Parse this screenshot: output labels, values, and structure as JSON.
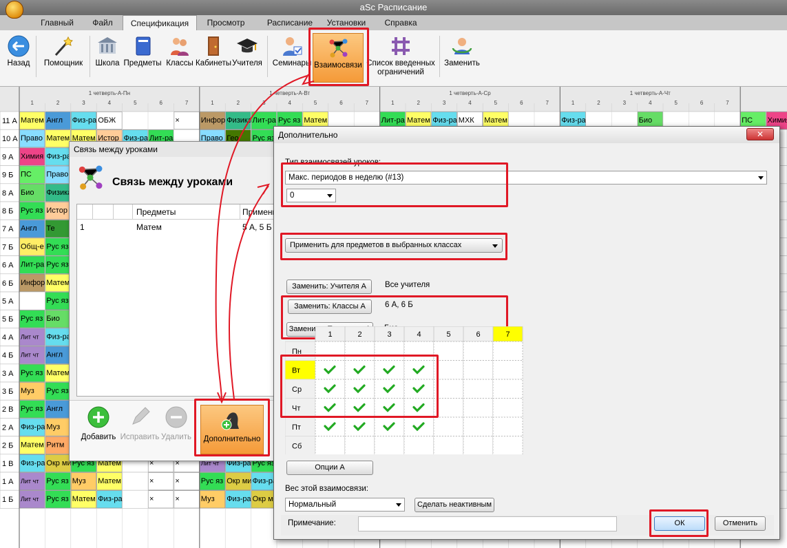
{
  "app": {
    "title": "aSc Расписание"
  },
  "menu": [
    "Главный",
    "Файл",
    "Спецификация",
    "Просмотр",
    "Расписание",
    "Установки",
    "Справка"
  ],
  "ribbon": {
    "back": "Назад",
    "wizard": "Помощник",
    "school": "Школа",
    "subjects": "Предметы",
    "classes": "Классы",
    "rooms": "Кабинеты",
    "teachers": "Учителя",
    "seminars": "Семинары",
    "relations": "Взаимосвязи",
    "constraints_line1": "Список введенных",
    "constraints_line2": "ограничений",
    "replace": "Заменить"
  },
  "grid": {
    "day_headers": [
      "1 четверть-А-Пн",
      "1 четверть-А-Вт",
      "1 четверть-А-Ср",
      "1 четверть-А-Чт"
    ],
    "periods": [
      "1",
      "2",
      "3",
      "4",
      "5",
      "6",
      "7"
    ],
    "rows": [
      {
        "cls": "11 А",
        "cells": [
          "Матем",
          "Англ",
          "Физ-ра",
          "ОБЖ",
          "",
          "",
          "×",
          "Инфор",
          "Физика",
          "Лит-ра",
          "Рус яз",
          "Матем",
          "",
          "",
          "Лит-ра",
          "Матем",
          "Физ-ра",
          "МХК",
          "Матем",
          "",
          "",
          "Физ-ра",
          "",
          "",
          "Био",
          "",
          "",
          "",
          "ПС",
          "Химия"
        ]
      },
      {
        "cls": "10 А",
        "cells": [
          "Право",
          "Матем",
          "Матем",
          "Истор",
          "Физ-ра",
          "Лит-ра",
          "",
          "Право",
          "Гео",
          "Рус яз",
          "",
          "",
          "",
          "",
          "",
          "",
          "",
          "",
          "",
          "",
          "",
          "",
          "",
          "",
          "",
          "",
          "",
          "",
          "",
          ""
        ]
      },
      {
        "cls": "9 А",
        "cells": [
          "Химия",
          "Физ-ра",
          "",
          "",
          "",
          "",
          "",
          "",
          "",
          "",
          "",
          "",
          "",
          "",
          "",
          "",
          "",
          "",
          "",
          "",
          "",
          "",
          "",
          "",
          "",
          "",
          "",
          "",
          "",
          ""
        ]
      },
      {
        "cls": "9 Б",
        "cells": [
          "ПС",
          "Право",
          "",
          "",
          "",
          "",
          "",
          "",
          "",
          "",
          "",
          "",
          "",
          "",
          "",
          "",
          "",
          "",
          "",
          "",
          "",
          "",
          "",
          "",
          "",
          "",
          "",
          "",
          "",
          ""
        ]
      },
      {
        "cls": "8 А",
        "cells": [
          "Био",
          "Физика",
          "",
          "",
          "",
          "",
          "",
          "",
          "",
          "",
          "",
          "",
          "",
          "",
          "",
          "",
          "",
          "",
          "",
          "",
          "",
          "",
          "",
          "",
          "",
          "",
          "",
          "",
          "",
          ""
        ]
      },
      {
        "cls": "8 Б",
        "cells": [
          "Рус яз",
          "Истор",
          "",
          "",
          "",
          "",
          "",
          "",
          "",
          "",
          "",
          "",
          "",
          "",
          "",
          "",
          "",
          "",
          "",
          "",
          "",
          "",
          "",
          "",
          "",
          "",
          "",
          "",
          "",
          ""
        ]
      },
      {
        "cls": "7 А",
        "cells": [
          "Англ",
          "Те",
          "",
          "",
          "",
          "",
          "",
          "",
          "",
          "",
          "",
          "",
          "",
          "",
          "",
          "",
          "",
          "",
          "",
          "",
          "",
          "",
          "",
          "",
          "",
          "",
          "",
          "",
          "",
          ""
        ]
      },
      {
        "cls": "7 Б",
        "cells": [
          "Общ-е",
          "Рус яз",
          "",
          "",
          "",
          "",
          "",
          "",
          "",
          "",
          "",
          "",
          "",
          "",
          "",
          "",
          "",
          "",
          "",
          "",
          "",
          "",
          "",
          "",
          "",
          "",
          "",
          "",
          "",
          ""
        ]
      },
      {
        "cls": "6 А",
        "cells": [
          "Лит-ра",
          "Рус яз",
          "",
          "",
          "",
          "",
          "",
          "",
          "",
          "",
          "",
          "",
          "",
          "",
          "",
          "",
          "",
          "",
          "",
          "",
          "",
          "",
          "",
          "",
          "",
          "",
          "",
          "",
          "",
          ""
        ]
      },
      {
        "cls": "6 Б",
        "cells": [
          "Инфор",
          "Матем",
          "",
          "",
          "",
          "",
          "",
          "",
          "",
          "",
          "",
          "",
          "",
          "",
          "",
          "",
          "",
          "",
          "",
          "",
          "",
          "",
          "",
          "",
          "",
          "",
          "",
          "",
          "",
          ""
        ]
      },
      {
        "cls": "5 А",
        "cells": [
          "",
          "Рус яз",
          "",
          "",
          "",
          "",
          "",
          "",
          "",
          "",
          "",
          "",
          "",
          "",
          "",
          "",
          "",
          "",
          "",
          "",
          "",
          "",
          "",
          "",
          "",
          "",
          "",
          "",
          "",
          ""
        ]
      },
      {
        "cls": "5 Б",
        "cells": [
          "Рус яз",
          "Био",
          "",
          "",
          "",
          "",
          "",
          "",
          "",
          "",
          "",
          "",
          "",
          "",
          "",
          "",
          "",
          "",
          "",
          "",
          "",
          "",
          "",
          "",
          "",
          "",
          "",
          "",
          "",
          ""
        ]
      },
      {
        "cls": "4 А",
        "cells": [
          "Лит чтение",
          "Физ-ра",
          "",
          "",
          "",
          "",
          "",
          "",
          "",
          "",
          "",
          "",
          "",
          "",
          "",
          "",
          "",
          "",
          "",
          "",
          "",
          "",
          "",
          "",
          "",
          "",
          "",
          "",
          "",
          ""
        ]
      },
      {
        "cls": "4 Б",
        "cells": [
          "Лит чтение",
          "Англ",
          "",
          "",
          "",
          "",
          "",
          "",
          "",
          "",
          "",
          "",
          "",
          "",
          "",
          "",
          "",
          "",
          "",
          "",
          "",
          "",
          "",
          "",
          "",
          "",
          "",
          "",
          "",
          ""
        ]
      },
      {
        "cls": "3 А",
        "cells": [
          "Рус яз",
          "Матем",
          "",
          "",
          "",
          "",
          "",
          "",
          "",
          "",
          "",
          "",
          "",
          "",
          "",
          "",
          "",
          "",
          "",
          "",
          "",
          "",
          "",
          "",
          "",
          "",
          "",
          "",
          "",
          ""
        ]
      },
      {
        "cls": "3 Б",
        "cells": [
          "Муз",
          "Рус яз",
          "",
          "",
          "",
          "",
          "",
          "",
          "",
          "",
          "",
          "",
          "",
          "",
          "",
          "",
          "",
          "",
          "",
          "",
          "",
          "",
          "",
          "",
          "",
          "",
          "",
          "",
          "",
          ""
        ]
      },
      {
        "cls": "2 В",
        "cells": [
          "Рус яз",
          "Англ",
          "",
          "",
          "",
          "",
          "",
          "",
          "",
          "",
          "",
          "",
          "",
          "",
          "",
          "",
          "",
          "",
          "",
          "",
          "",
          "",
          "",
          "",
          "",
          "",
          "",
          "",
          "",
          ""
        ]
      },
      {
        "cls": "2 А",
        "cells": [
          "Физ-ра",
          "Муз",
          "",
          "",
          "",
          "",
          "",
          "",
          "",
          "",
          "",
          "",
          "",
          "",
          "",
          "",
          "",
          "",
          "",
          "",
          "",
          "",
          "",
          "",
          "",
          "",
          "",
          "",
          "",
          ""
        ]
      },
      {
        "cls": "2 Б",
        "cells": [
          "Матем",
          "Ритм",
          "",
          "",
          "",
          "",
          "",
          "",
          "",
          "",
          "",
          "",
          "",
          "",
          "",
          "",
          "",
          "",
          "",
          "",
          "",
          "",
          "",
          "",
          "",
          "",
          "",
          "",
          "",
          ""
        ]
      },
      {
        "cls": "1 В",
        "cells": [
          "Физ-ра",
          "Окр мир",
          "Рус яз",
          "Матем",
          "",
          "×",
          "×",
          "Лит чтение",
          "Физ-ра",
          "Рус яз",
          "",
          "",
          "",
          "",
          "",
          "",
          "",
          "",
          "",
          "",
          "",
          "",
          "",
          "",
          "",
          "",
          "",
          "",
          "",
          ""
        ]
      },
      {
        "cls": "1 А",
        "cells": [
          "Лит чтение",
          "Рус яз",
          "Муз",
          "Матем",
          "",
          "×",
          "×",
          "Рус яз",
          "Окр мир",
          "Физ-ра",
          "",
          "",
          "",
          "",
          "",
          "",
          "",
          "",
          "",
          "",
          "",
          "",
          "",
          "",
          "",
          "",
          "",
          "",
          "",
          ""
        ]
      },
      {
        "cls": "1 Б",
        "cells": [
          "Лит чтение",
          "Рус яз",
          "Матем",
          "Физ-ра",
          "",
          "×",
          "×",
          "Муз",
          "Физ-ра",
          "Окр мир",
          "",
          "",
          "",
          "",
          "",
          "",
          "",
          "",
          "",
          "",
          "",
          "",
          "",
          "",
          "",
          "",
          "",
          "",
          "",
          ""
        ]
      }
    ]
  },
  "dlg1": {
    "title": "Связь между уроками",
    "heading": "Связь между уроками",
    "col_subjects": "Предметы",
    "col_apply": "Примени",
    "row_num": "1",
    "row_subject": "Матем",
    "row_apply": "5 А, 5 Б",
    "add": "Добавить",
    "edit": "Исправить",
    "delete": "Удалить",
    "extra": "Дополнительно"
  },
  "dlg2": {
    "title": "Дополнительно",
    "type_label": "Тип взаимосвязей уроков:",
    "type_value": "Макс. периодов в неделю (#13)",
    "count_value": "0",
    "apply_value": "Применить для предметов в выбранных классах",
    "replace_teachers": "Заменить: Учителя А",
    "teachers_value": "Все учителя",
    "replace_classes": "Заменить: Классы А",
    "classes_value": "6 А, 6 Б",
    "replace_subjects": "Заменить: Предметы А",
    "subjects_value": "Био",
    "periods": [
      "1",
      "2",
      "3",
      "4",
      "5",
      "6",
      "7"
    ],
    "days": [
      "Пн",
      "Вт",
      "Ср",
      "Чт",
      "Пт",
      "Сб"
    ],
    "options": "Опции А",
    "weight_label": "Вес этой взаимосвязи:",
    "weight_value": "Нормальный",
    "inactive": "Сделать неактивным",
    "note_label": "Примечание:",
    "ok": "ОК",
    "cancel": "Отменить"
  },
  "colors": {
    "accent": "#e01825",
    "highlight_yellow": "#ffff00",
    "relations_orange": "#f7a34a"
  }
}
